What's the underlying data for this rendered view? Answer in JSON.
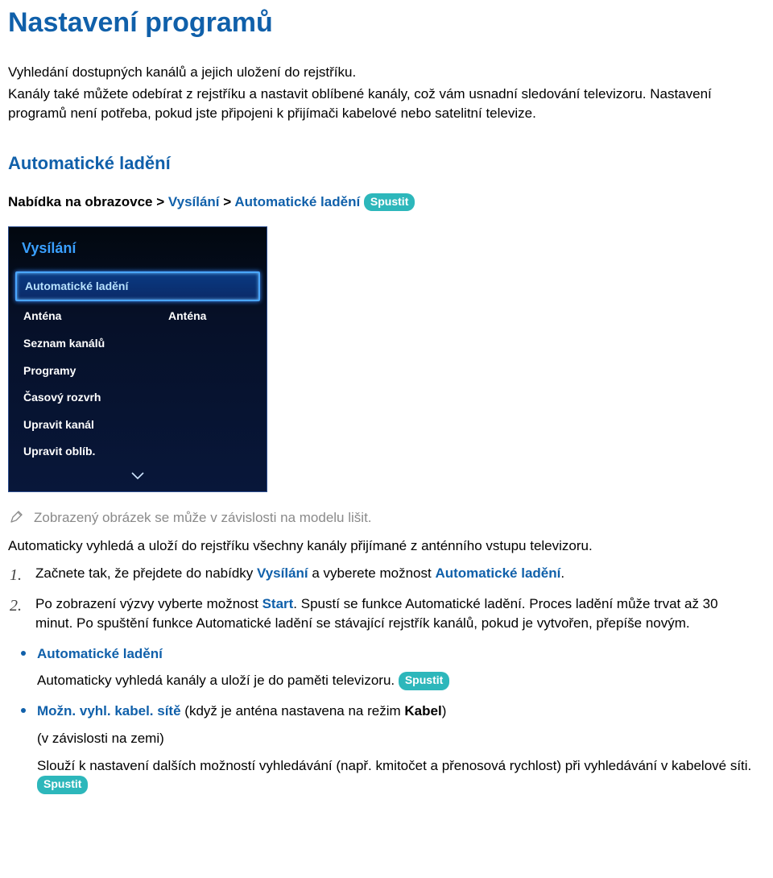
{
  "title": "Nastavení programů",
  "intro1": "Vyhledání dostupných kanálů a jejich uložení do rejstříku.",
  "intro2": "Kanály také můžete odebírat z rejstříku a nastavit oblíbené kanály, což vám usnadní sledování televizoru. Nastavení programů není potřeba, pokud jste připojeni k přijímači kabelové nebo satelitní televize.",
  "section_title": "Automatické ladění",
  "breadcrumb": {
    "root": "Nabídka na obrazovce",
    "a": "Vysílání",
    "b": "Automatické ladění",
    "badge": "Spustit"
  },
  "panel": {
    "title": "Vysílání",
    "items": [
      {
        "label": "Automatické ladění",
        "value": "",
        "selected": true
      },
      {
        "label": "Anténa",
        "value": "Anténa",
        "selected": false
      },
      {
        "label": "Seznam kanálů",
        "value": "",
        "selected": false
      },
      {
        "label": "Programy",
        "value": "",
        "selected": false
      },
      {
        "label": "Časový rozvrh",
        "value": "",
        "selected": false
      },
      {
        "label": "Upravit kanál",
        "value": "",
        "selected": false
      },
      {
        "label": "Upravit oblíb.",
        "value": "",
        "selected": false
      }
    ]
  },
  "note": "Zobrazený obrázek se může v závislosti na modelu lišit.",
  "para_above_steps": "Automaticky vyhledá a uloží do rejstříku všechny kanály přijímané z anténního vstupu televizoru.",
  "step1": {
    "p1": "Začnete tak, že přejdete do nabídky ",
    "b1": "Vysílání",
    "p2": " a vyberete možnost ",
    "b2": "Automatické ladění",
    "p3": "."
  },
  "step2": {
    "p1": "Po zobrazení výzvy vyberte možnost ",
    "b1": "Start",
    "p2": ". Spustí se funkce Automatické ladění. Proces ladění může trvat až 30 minut. Po spuštění funkce Automatické ladění se stávající rejstřík kanálů, pokud je vytvořen, přepíše novým."
  },
  "sub1": {
    "title": "Automatické ladění",
    "desc1": "Automaticky vyhledá kanály a uloží je do paměti televizoru. ",
    "badge": "Spustit"
  },
  "sub2": {
    "title_a": "Možn. vyhl. kabel. sítě",
    "title_b": " (když je anténa nastavena na režim ",
    "title_c": "Kabel",
    "title_d": ")",
    "note": "(v závislosti na zemi)",
    "desc": "Slouží k nastavení dalších možností vyhledávání (např. kmitočet a přenosová rychlost) při vyhledávání v kabelové síti. ",
    "badge": "Spustit"
  }
}
